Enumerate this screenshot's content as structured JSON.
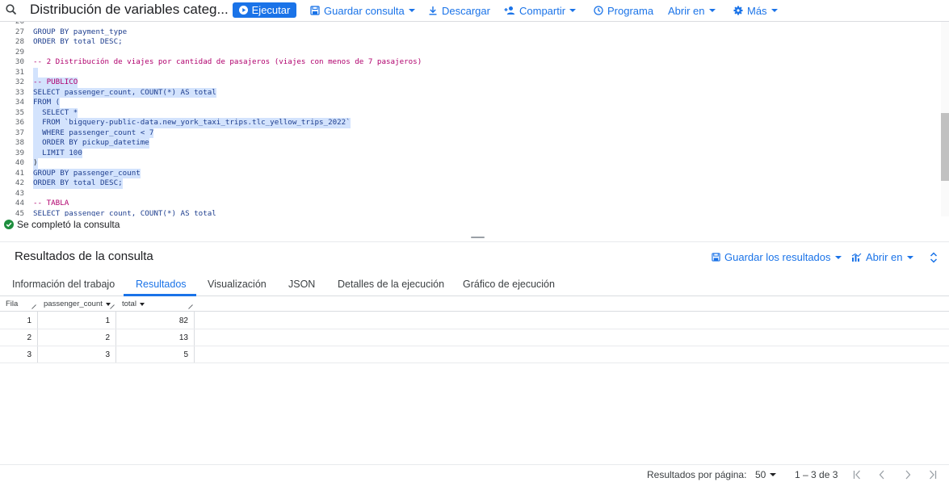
{
  "toolbar": {
    "title": "Distribución de variables categ...",
    "run_label": "Ejecutar",
    "save_query_label": "Guardar consulta",
    "download_label": "Descargar",
    "share_label": "Compartir",
    "schedule_label": "Programa",
    "open_in_label": "Abrir en",
    "more_label": "Más"
  },
  "editor": {
    "lines": [
      {
        "n": "26",
        "text": ""
      },
      {
        "n": "27",
        "text": "GROUP BY payment_type"
      },
      {
        "n": "28",
        "text": "ORDER BY total DESC;"
      },
      {
        "n": "29",
        "text": ""
      },
      {
        "n": "30",
        "text": "-- 2 Distribución de viajes por cantidad de pasajeros (viajes con menos de 7 pasajeros)"
      },
      {
        "n": "31",
        "text": ""
      },
      {
        "n": "32",
        "text": "-- PUBLICO"
      },
      {
        "n": "33",
        "text": "SELECT passenger_count, COUNT(*) AS total"
      },
      {
        "n": "34",
        "text": "FROM ("
      },
      {
        "n": "35",
        "text": "  SELECT *"
      },
      {
        "n": "36",
        "text": "  FROM `bigquery-public-data.new_york_taxi_trips.tlc_yellow_trips_2022`"
      },
      {
        "n": "37",
        "text": "  WHERE passenger_count < 7"
      },
      {
        "n": "38",
        "text": "  ORDER BY pickup_datetime"
      },
      {
        "n": "39",
        "text": "  LIMIT 100"
      },
      {
        "n": "40",
        "text": ")"
      },
      {
        "n": "41",
        "text": "GROUP BY passenger_count"
      },
      {
        "n": "42",
        "text": "ORDER BY total DESC;"
      },
      {
        "n": "43",
        "text": ""
      },
      {
        "n": "44",
        "text": "-- TABLA"
      },
      {
        "n": "45",
        "text": "SELECT passenger_count, COUNT(*) AS total"
      }
    ]
  },
  "status": {
    "message": "Se completó la consulta"
  },
  "results": {
    "title": "Resultados de la consulta",
    "save_results_label": "Guardar los resultados",
    "open_in_label": "Abrir en",
    "tabs": [
      {
        "label": "Información del trabajo"
      },
      {
        "label": "Resultados"
      },
      {
        "label": "Visualización"
      },
      {
        "label": "JSON"
      },
      {
        "label": "Detalles de la ejecución"
      },
      {
        "label": "Gráfico de ejecución"
      }
    ],
    "columns": [
      "Fila",
      "passenger_count",
      "total"
    ],
    "rows": [
      [
        "1",
        "1",
        "82"
      ],
      [
        "2",
        "2",
        "13"
      ],
      [
        "3",
        "3",
        "5"
      ]
    ]
  },
  "footer": {
    "per_page_label": "Resultados por página:",
    "per_page_value": "50",
    "range_label": "1 – 3 de 3"
  },
  "colors": {
    "accent": "#1a73e8",
    "selection": "#d3e3fd",
    "success": "#1e8e3e"
  }
}
